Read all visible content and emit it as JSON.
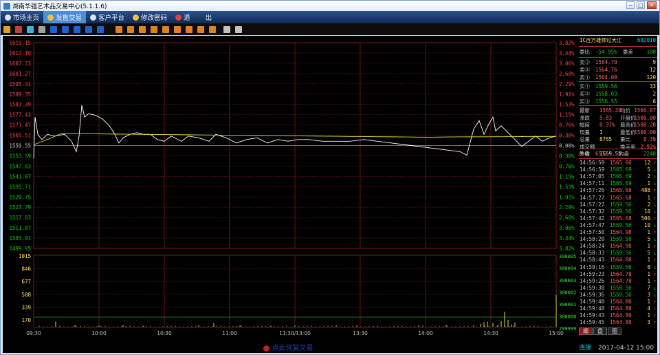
{
  "window": {
    "title": "湖南华强艺术品交易中心(5.1.1.6)"
  },
  "menu": [
    {
      "label": "市场主页",
      "icon": "globe-icon",
      "active": false
    },
    {
      "label": "发售交易",
      "icon": "hand-icon",
      "active": true
    },
    {
      "label": "客户平台",
      "icon": "globe-icon",
      "active": false
    },
    {
      "label": "修改密码",
      "icon": "key-icon",
      "active": false
    },
    {
      "label": "退",
      "icon": "power-icon",
      "active": false
    },
    {
      "label": "出",
      "icon": "",
      "active": false
    }
  ],
  "toolbar_icons": [
    "bar-chart-icon",
    "line-chart-icon",
    "kline-icon",
    "calendar-icon",
    "f-icon",
    "s-icon",
    "grid-icon",
    "f2-icon",
    "k-icon",
    "a-icon",
    "b-icon",
    "c-icon",
    "d-icon",
    "e-icon",
    "f3-icon",
    "g-icon",
    "h-icon",
    "i-icon",
    "pen-icon",
    "gear-icon"
  ],
  "chart": {
    "price_ticks": [
      "1619.15",
      "1613.19",
      "1607.23",
      "1601.27",
      "1595.31",
      "1589.35",
      "1583.39",
      "1577.43",
      "1571.47",
      "1565.51",
      "1559.55",
      "1553.59",
      "1547.63",
      "1541.67",
      "1535.71",
      "1529.75",
      "1523.79",
      "1517.83",
      "1511.87",
      "1505.91",
      "1499.95"
    ],
    "pct_ticks": [
      "3.82%",
      "3.44%",
      "3.06%",
      "2.68%",
      "2.29%",
      "1.91%",
      "1.53%",
      "1.15%",
      "0.76%",
      "0.38%",
      "0.00%",
      "0.38%",
      "0.76%",
      "1.15%",
      "1.53%",
      "1.91%",
      "2.29%",
      "2.68%",
      "3.06%",
      "3.44%",
      "3.82%"
    ],
    "vol_ticks_left": [
      "1015",
      "846",
      "677",
      "508",
      "339",
      "170"
    ],
    "vol_ticks_right": [
      "300005",
      "300004",
      "300003",
      "300002",
      "300001",
      "300000",
      "299999"
    ],
    "time_ticks": [
      "09:30",
      "10:00",
      "10:30",
      "11:00",
      "11:30/13:00",
      "13:30",
      "14:00",
      "14:30",
      "15:00"
    ]
  },
  "chart_data": {
    "type": "line",
    "x": [
      "09:30",
      "10:00",
      "10:30",
      "11:00",
      "11:30/13:00",
      "13:30",
      "14:00",
      "14:30",
      "15:00"
    ],
    "series": [],
    "ylim": [
      1499.95,
      1619.15
    ],
    "base_price": 1559.55,
    "volume_ylim": [
      0,
      1015
    ]
  },
  "panel": {
    "title": "IC百万雄师过大江",
    "code": "602010",
    "weibi_label": "委比",
    "weibi_value": "-54.95%",
    "weicha_label": "委差",
    "weicha_value": "100",
    "asks": [
      {
        "label": "卖③",
        "price": "1564.79",
        "qty": "9"
      },
      {
        "label": "卖②",
        "price": "1564.76",
        "qty": "12"
      },
      {
        "label": "卖①",
        "price": "1564.00",
        "qty": "120"
      }
    ],
    "bids": [
      {
        "label": "买①",
        "price": "1559.56",
        "qty": "33"
      },
      {
        "label": "买②",
        "price": "1558.03",
        "qty": "2"
      },
      {
        "label": "买③",
        "price": "1556.55",
        "qty": "6"
      }
    ],
    "stats": [
      {
        "l1": "最新",
        "v1": "1565.38",
        "l2": "均价",
        "v2": "1566.87"
      },
      {
        "l1": "涨跌",
        "v1": "5.83",
        "l2": "开盘价",
        "v2": "1500.00"
      },
      {
        "l1": "幅度",
        "v1": "0.37%",
        "l2": "最高价",
        "v2": "1588.20"
      },
      {
        "l1": "现量",
        "v1": "1",
        "l2": "最低价",
        "v2": "1500.00"
      },
      {
        "l1": "总量",
        "v1": "8765",
        "l2": "量比",
        "v2": "0.39"
      },
      {
        "l1": "成交额",
        "v1": "",
        "l2": "换手率",
        "v2": "2.92%"
      },
      {
        "l1": "昨收",
        "v1": "1559.55",
        "l2": "",
        "v2": ""
      }
    ],
    "waipan_label": "外盘",
    "waipan_value": "6517",
    "neipan_label": "内盘",
    "neipan_value": "2248",
    "ticks": [
      {
        "t": "14:56:59",
        "p": "1565.60",
        "q": "12",
        "d": "↑"
      },
      {
        "t": "14:56:59",
        "p": "1565.69",
        "q": "5",
        "d": "↓"
      },
      {
        "t": "14:57:05",
        "p": "1565.69",
        "q": "2",
        "d": "↓"
      },
      {
        "t": "14:57:11",
        "p": "1565.69",
        "q": "1",
        "d": "↓"
      },
      {
        "t": "14:57:26",
        "p": "1565.68",
        "q": "488",
        "d": "↑"
      },
      {
        "t": "14:57:27",
        "p": "1565.68",
        "q": "1",
        "d": "↑"
      },
      {
        "t": "14:57:27",
        "p": "1559.56",
        "q": "2",
        "d": "↓"
      },
      {
        "t": "14:57:32",
        "p": "1559.56",
        "q": "10",
        "d": "↓"
      },
      {
        "t": "14:57:42",
        "p": "1565.68",
        "q": "500",
        "d": "↑"
      },
      {
        "t": "14:57:47",
        "p": "1559.56",
        "q": "10",
        "d": "↓"
      },
      {
        "t": "14:57:50",
        "p": "1564.98",
        "q": "1",
        "d": "↑"
      },
      {
        "t": "14:58:20",
        "p": "1559.56",
        "q": "5",
        "d": "↓"
      },
      {
        "t": "14:58:24",
        "p": "1564.98",
        "q": "1",
        "d": "↑"
      },
      {
        "t": "14:58:33",
        "p": "1559.56",
        "q": "5",
        "d": "↓"
      },
      {
        "t": "14:58:43",
        "p": "1564.88",
        "q": "1",
        "d": "↑"
      },
      {
        "t": "14:59:16",
        "p": "1559.56",
        "q": "8",
        "d": "↓"
      },
      {
        "t": "14:59:23",
        "p": "1564.78",
        "q": "1",
        "d": "↑"
      },
      {
        "t": "14:59:26",
        "p": "1564.78",
        "q": "1",
        "d": "↑"
      },
      {
        "t": "14:59:30",
        "p": "1559.56",
        "q": "7",
        "d": "↓"
      },
      {
        "t": "14:59:36",
        "p": "1559.56",
        "q": "3",
        "d": "↓"
      },
      {
        "t": "14:59:40",
        "p": "1564.80",
        "q": "1",
        "d": "↑"
      },
      {
        "t": "14:59:40",
        "p": "1564.80",
        "q": "4",
        "d": "↑"
      },
      {
        "t": "14:59:43",
        "p": "1564.80",
        "q": "1",
        "d": "↑"
      },
      {
        "t": "14:59:45",
        "p": "1564.80",
        "q": "3",
        "d": "↑"
      }
    ],
    "tabs": [
      "细",
      "盘",
      "图"
    ]
  },
  "status": {
    "conn": "连接",
    "time": "2017-04-12 15:00"
  },
  "restore_button": "点此恢复交易",
  "colors": {
    "up": "#ff4040",
    "down": "#00d000",
    "grid": "#801818",
    "price_line": "#ffffff",
    "avg_line": "#e0e040"
  }
}
